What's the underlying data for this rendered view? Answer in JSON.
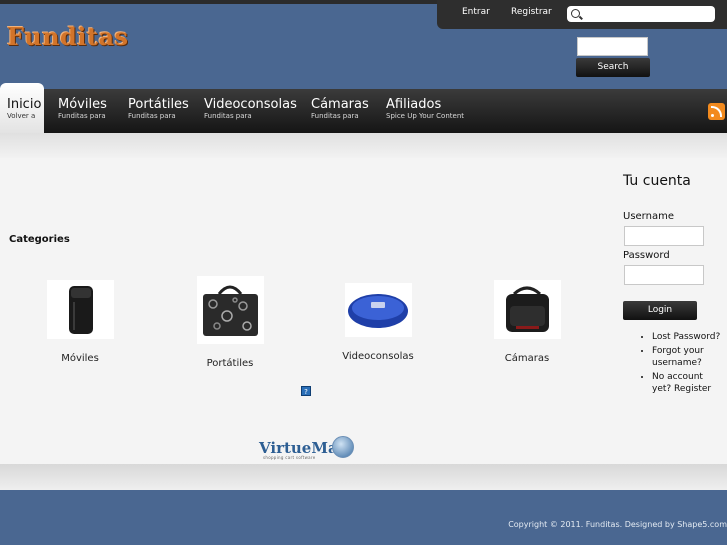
{
  "site": {
    "logo": "Funditas"
  },
  "topbar": {
    "login": "Entrar",
    "register": "Registrar",
    "search_placeholder": ""
  },
  "search_module": {
    "button": "Search",
    "placeholder": ""
  },
  "nav": [
    {
      "title": "Inicio",
      "subtitle": "Volver a"
    },
    {
      "title": "Móviles",
      "subtitle": "Funditas para"
    },
    {
      "title": "Portátiles",
      "subtitle": "Funditas para"
    },
    {
      "title": "Videoconsolas",
      "subtitle": "Funditas para"
    },
    {
      "title": "Cámaras",
      "subtitle": "Funditas para"
    },
    {
      "title": "Afiliados",
      "subtitle": "Spice Up Your Content"
    }
  ],
  "categories": {
    "title": "Categories",
    "items": [
      {
        "label": "Móviles"
      },
      {
        "label": "Portátiles"
      },
      {
        "label": "Videoconsolas"
      },
      {
        "label": "Cámaras"
      }
    ]
  },
  "help_icon": "?",
  "virtuemart": {
    "name": "VirtueMart",
    "tagline": "shopping cart software"
  },
  "account": {
    "title": "Tu cuenta",
    "username_label": "Username",
    "password_label": "Password",
    "login_button": "Login",
    "links": [
      "Lost Password?",
      "Forgot your username?",
      "No account yet? Register"
    ]
  },
  "footer": {
    "copyright": "Copyright © 2011. Funditas. Designed by Shape5.com"
  },
  "colors": {
    "header_blue": "#4a6791",
    "logo_orange": "#d2742a",
    "rss_orange": "#f28a1e"
  }
}
